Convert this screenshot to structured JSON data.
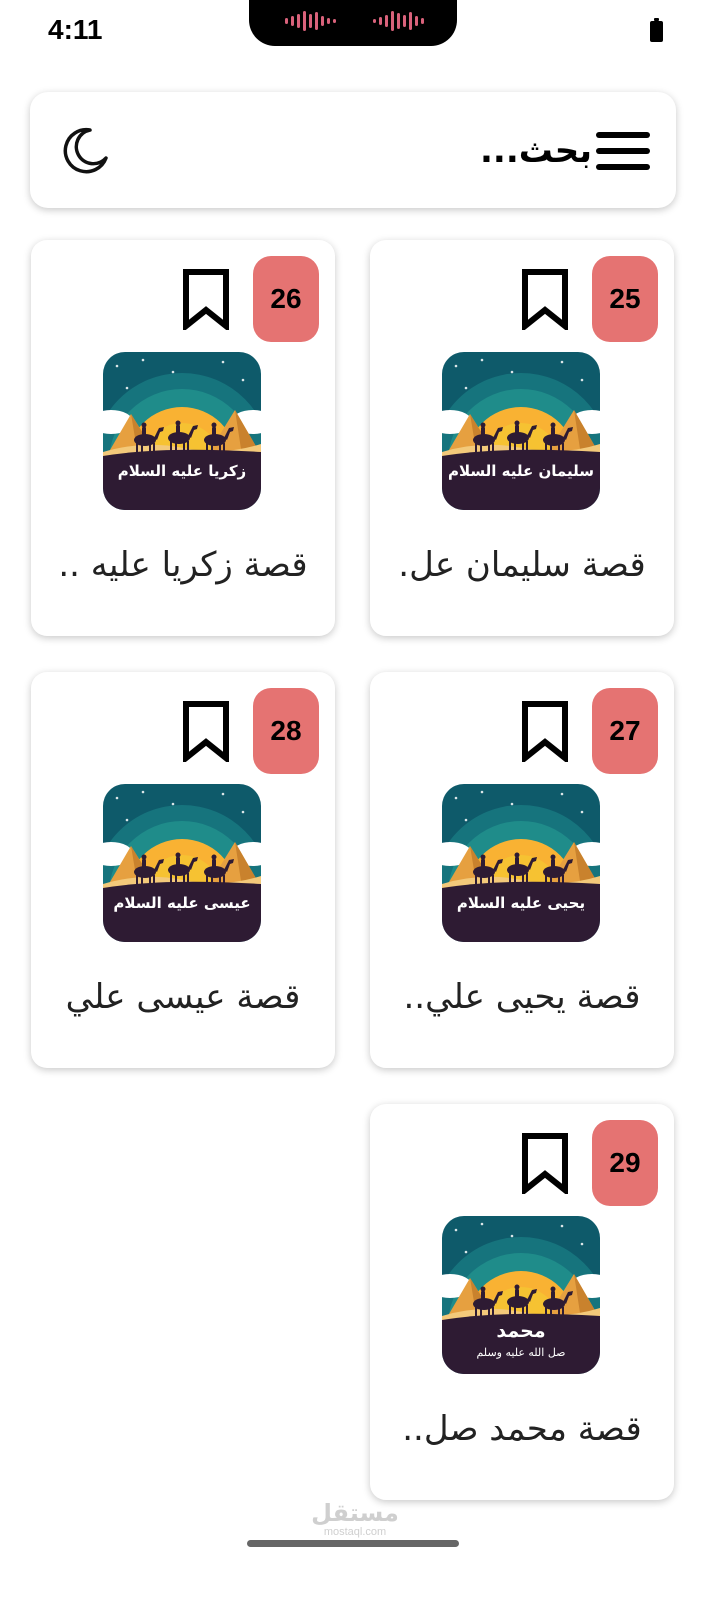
{
  "status_bar": {
    "time": "4:11"
  },
  "header": {
    "search_placeholder": "بحث..."
  },
  "stories": [
    {
      "number": "26",
      "thumb_label": "زكريا عليه السلام",
      "thumb_sublabel": "",
      "title": "قصة زكريا عليه .."
    },
    {
      "number": "25",
      "thumb_label": "سليمان عليه السلام",
      "thumb_sublabel": "",
      "title": "قصة سليمان عل."
    },
    {
      "number": "28",
      "thumb_label": "عيسى عليه السلام",
      "thumb_sublabel": "",
      "title": "قصة عيسى علي"
    },
    {
      "number": "27",
      "thumb_label": "يحيى عليه السلام",
      "thumb_sublabel": "",
      "title": "قصة يحيى علي.."
    },
    {
      "number": "29",
      "thumb_label": "محمد",
      "thumb_sublabel": "صل الله عليه وسلم",
      "title": "قصة محمد صل.."
    }
  ],
  "watermark": {
    "arabic": "مستقل",
    "latin": "mostaql.com"
  },
  "colors": {
    "badge": "#e57372",
    "thumb_sky": "#0e5a6a",
    "sun": "#f6c232",
    "ground": "#2e1b33"
  }
}
